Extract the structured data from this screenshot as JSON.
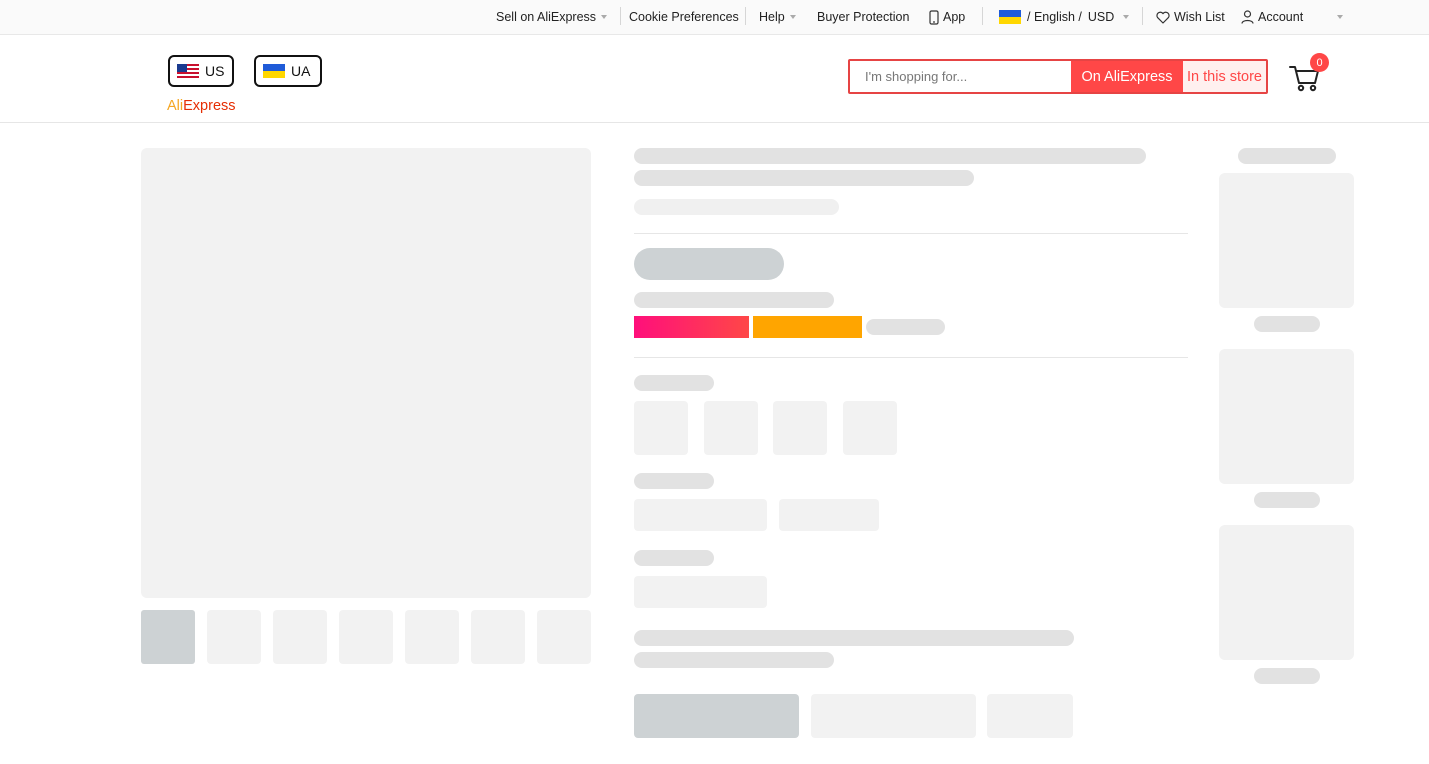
{
  "topbar": {
    "sell": "Sell on AliExpress",
    "cookie": "Cookie Preferences",
    "help": "Help",
    "buyer_protection": "Buyer Protection",
    "app": "App",
    "lang": "/ English /",
    "currency": "USD",
    "wishlist": "Wish List",
    "account": "Account"
  },
  "header": {
    "country_us": "US",
    "country_ua": "UA",
    "logo_part1": "Ali",
    "logo_part2": "Express",
    "search_placeholder": "I'm shopping for...",
    "search_on_aliexpress": "On AliExpress",
    "search_in_store": "In this store",
    "cart_count": "0"
  },
  "colors": {
    "accent": "#ff4747",
    "logo_orange": "#f5a623",
    "logo_red": "#e62e04",
    "promo_gradient_start": "#ff0f7b",
    "promo_gradient_end": "#ff4747",
    "promo_orange": "#ffa500"
  },
  "icons": [
    "phone-icon",
    "heart-icon",
    "user-icon",
    "cart-icon",
    "chevron-down-icon"
  ]
}
